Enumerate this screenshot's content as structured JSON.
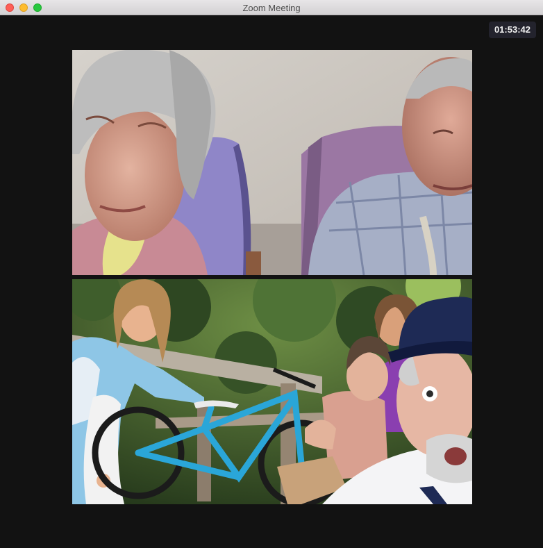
{
  "window": {
    "title": "Zoom Meeting"
  },
  "meeting": {
    "elapsed_time": "01:53:42"
  },
  "video_tiles": [
    {
      "description": "elderly couple seated in lilac armchairs"
    },
    {
      "description": "children with a blue mountain bike and a man in a navy hat outdoors"
    }
  ],
  "colors": {
    "titlebar": "#dcdadc",
    "stage_background": "#121212",
    "timer_background": "#23232d",
    "bike_blue": "#2aa6d8"
  }
}
